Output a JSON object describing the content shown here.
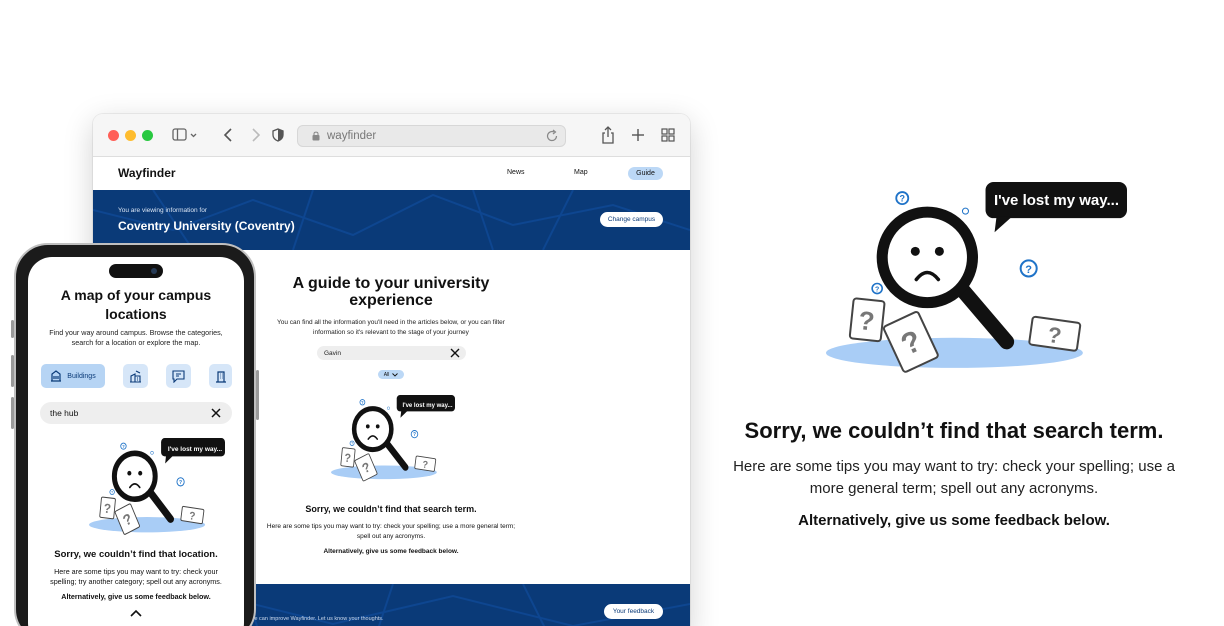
{
  "browser": {
    "url": "wayfinder",
    "site": {
      "logo": "Wayfinder",
      "nav": [
        "News",
        "Map",
        "Guide"
      ],
      "banner_small": "You are viewing information for",
      "banner_campus": "Coventry University (Coventry)",
      "change_campus_label": "Change campus",
      "guide_title": "A guide to your university experience",
      "guide_description": "You can find all the information you'll need in the articles below, or you can filter information so it's relevant to the stage of your journey",
      "search_value": "Gavin",
      "filter_label": "All",
      "empty_bubble": "I've lost my way...",
      "empty_heading": "Sorry, we couldn’t find that search term.",
      "empty_tips": "Here are some tips you may want to try: check your spelling; use a more general term; spell out any acronyms.",
      "empty_alt": "Alternatively, give us some feedback below.",
      "footer_text": "w we can improve Wayfinder. Let us know your thoughts.",
      "feedback_label": "Your feedback"
    }
  },
  "phone": {
    "title": "A map of your campus locations",
    "description": "Find your way around campus. Browse the categories, search for a location or explore the map.",
    "categories": [
      "Buildings",
      "buildings-alt-icon",
      "chat-icon",
      "office-icon"
    ],
    "search_value": "the hub",
    "empty_bubble": "I've lost my way...",
    "empty_heading": "Sorry, we couldn’t find that location.",
    "empty_tips": "Here are some tips you may want to try: check your spelling; try another category; spell out any acronyms.",
    "empty_alt": "Alternatively, give us some feedback below."
  },
  "hero": {
    "bubble": "I've lost my way...",
    "heading": "Sorry, we couldn’t find that search term.",
    "tips": "Here are some tips you may want to try: check your spelling; use a more general term; spell out any acronyms.",
    "alt": "Alternatively, give us some feedback below."
  },
  "colors": {
    "navy": "#0a3a78",
    "light_blue": "#bcd8f6",
    "puddle": "#a9cdf6",
    "question_blue": "#1f73c8"
  }
}
